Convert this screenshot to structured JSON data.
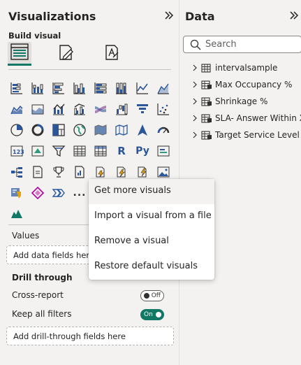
{
  "visualizations_pane": {
    "title": "Visualizations",
    "collapse_icon": "double-chevron-right-icon",
    "build_label": "Build visual",
    "build_tabs": [
      {
        "name": "build-visual-tab",
        "icon": "table-grid-icon",
        "selected": true
      },
      {
        "name": "format-visual-tab",
        "icon": "paint-brush-icon",
        "selected": false
      },
      {
        "name": "analytics-tab",
        "icon": "analytics-icon",
        "selected": false
      }
    ],
    "gallery_glyphs": {
      "r": "R",
      "python": "Py",
      "more": "..."
    },
    "values_label": "Values",
    "values_placeholder": "Add data fields here",
    "drill_through_label": "Drill through",
    "cross_report_label": "Cross-report",
    "cross_report_toggle": "Off",
    "keep_filters_label": "Keep all filters",
    "keep_filters_toggle": "On",
    "drill_placeholder": "Add drill-through fields here"
  },
  "data_pane": {
    "title": "Data",
    "collapse_icon": "double-chevron-right-icon",
    "search_placeholder": "Search",
    "tables": [
      {
        "label": "intervalsample",
        "icon": "table-icon"
      },
      {
        "label": "Max Occupancy %",
        "icon": "measure-table-icon"
      },
      {
        "label": "Shrinkage %",
        "icon": "measure-table-icon"
      },
      {
        "label": "SLA- Answer Within X ...",
        "icon": "measure-table-icon"
      },
      {
        "label": "Target Service Level %",
        "icon": "measure-table-icon"
      }
    ]
  },
  "context_menu": {
    "items": [
      {
        "label": "Get more visuals",
        "hovered": true
      },
      {
        "label": "Import a visual from a file",
        "hovered": false
      },
      {
        "label": "Remove a visual",
        "hovered": false
      },
      {
        "label": "Restore default visuals",
        "hovered": false
      }
    ]
  },
  "colors": {
    "accent_green": "#117865",
    "icon_blue": "#2b579a",
    "icon_teal": "#2e9c7f",
    "icon_dark": "#323130",
    "pane_bg": "#f3f2f1",
    "menu_bg": "#ffffff"
  }
}
